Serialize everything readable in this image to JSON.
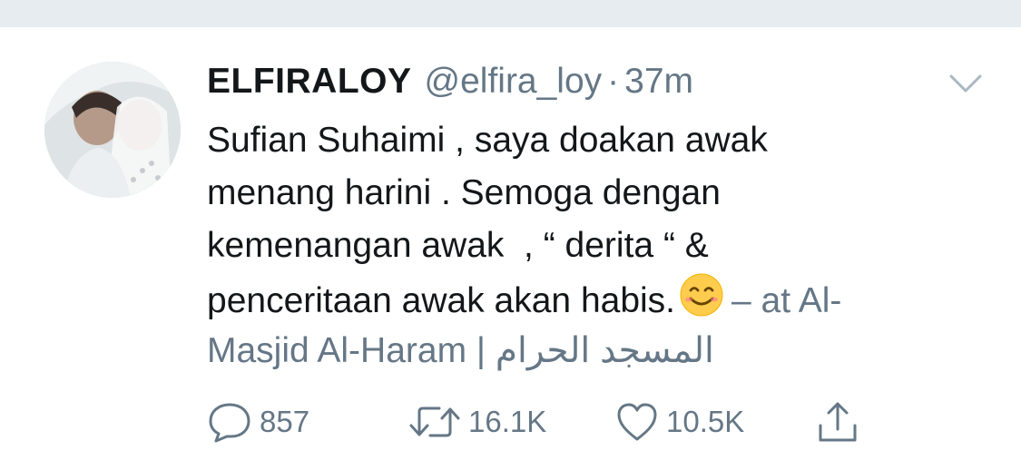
{
  "tweet": {
    "display_name": "ELFIRALOY",
    "handle": "@elfira_loy",
    "separator": "·",
    "time": "37m",
    "text_lines": [
      "Sufian Suhaimi , saya doakan awak",
      "menang harini . Semoga dengan",
      "kemenangan awak  , “ derita “ &",
      "penceritaan awak akan habis."
    ],
    "emoji": "smiling-face-emoji",
    "location_prefix": "– at Al-",
    "location_line2": "Masjid Al-Haram | المسجد الحرام",
    "reply_count": "857",
    "retweet_count": "16.1K",
    "like_count": "10.5K"
  },
  "icons": {
    "caret": "chevron-down-icon",
    "reply": "reply-bubble-icon",
    "retweet": "retweet-icon",
    "like": "heart-icon",
    "share": "share-icon"
  },
  "colors": {
    "text": "#14171a",
    "secondary": "#657786",
    "band": "#e6ecf0",
    "emoji_face": "#ffcc4d"
  }
}
